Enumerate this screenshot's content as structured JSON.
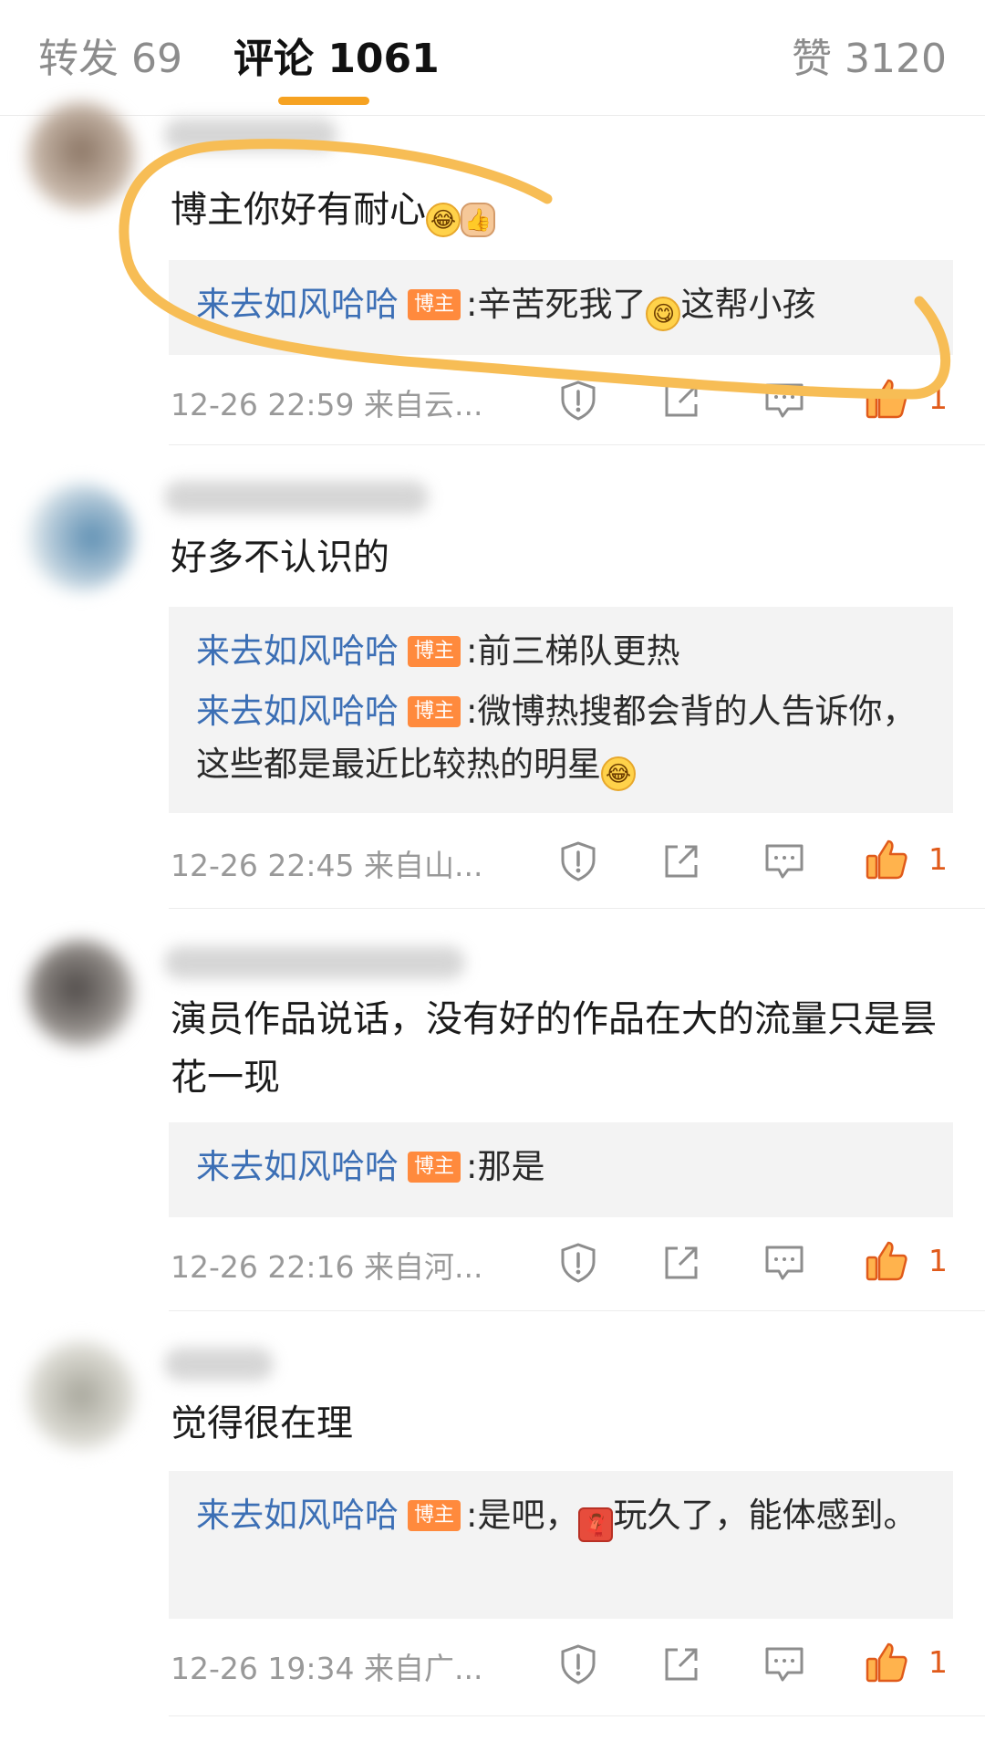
{
  "tabs": {
    "repost": "转发 69",
    "comments": "评论 1061",
    "likes": "赞 3120"
  },
  "blogger_badge": "博主",
  "comments": [
    {
      "text": "博主你好有耐心",
      "emojis": [
        "laugh-cry-emoji",
        "thumbs-up-emoji"
      ],
      "replies": [
        {
          "author": "来去如风哈哈",
          "sep": ":",
          "text_before": "辛苦死我了",
          "emoji": "yummy-emoji",
          "text_after": "这帮小孩"
        }
      ],
      "time": "12-26 22:59",
      "location": "来自云...",
      "like_count": "1"
    },
    {
      "text": "好多不认识的",
      "replies": [
        {
          "author": "来去如风哈哈",
          "sep": ":",
          "text": "前三梯队更热"
        },
        {
          "author": "来去如风哈哈",
          "sep": ":",
          "text": "微博热搜都会背的人告诉你，这些都是最近比较热的明星",
          "emoji": "laugh-cry-emoji"
        }
      ],
      "time": "12-26 22:45",
      "location": "来自山...",
      "like_count": "1"
    },
    {
      "text": "演员作品说话，没有好的作品在大的流量只是昙花一现",
      "replies": [
        {
          "author": "来去如风哈哈",
          "sep": ":",
          "text": "那是"
        }
      ],
      "time": "12-26 22:16",
      "location": "来自河...",
      "like_count": "1"
    },
    {
      "text": "觉得很在理",
      "replies": [
        {
          "author": "来去如风哈哈",
          "sep": ":",
          "text_before": "是吧，",
          "emoji": "scarf-emoji",
          "text_after": "玩久了，能体感到。"
        }
      ],
      "time": "12-26 19:34",
      "location": "来自广...",
      "like_count": "1"
    }
  ],
  "colors": {
    "accent": "#f6a221",
    "author_link": "#3c6fb5",
    "badge": "#ff8a3d",
    "like": "#e05a1a",
    "annotation": "#f7bd55"
  }
}
